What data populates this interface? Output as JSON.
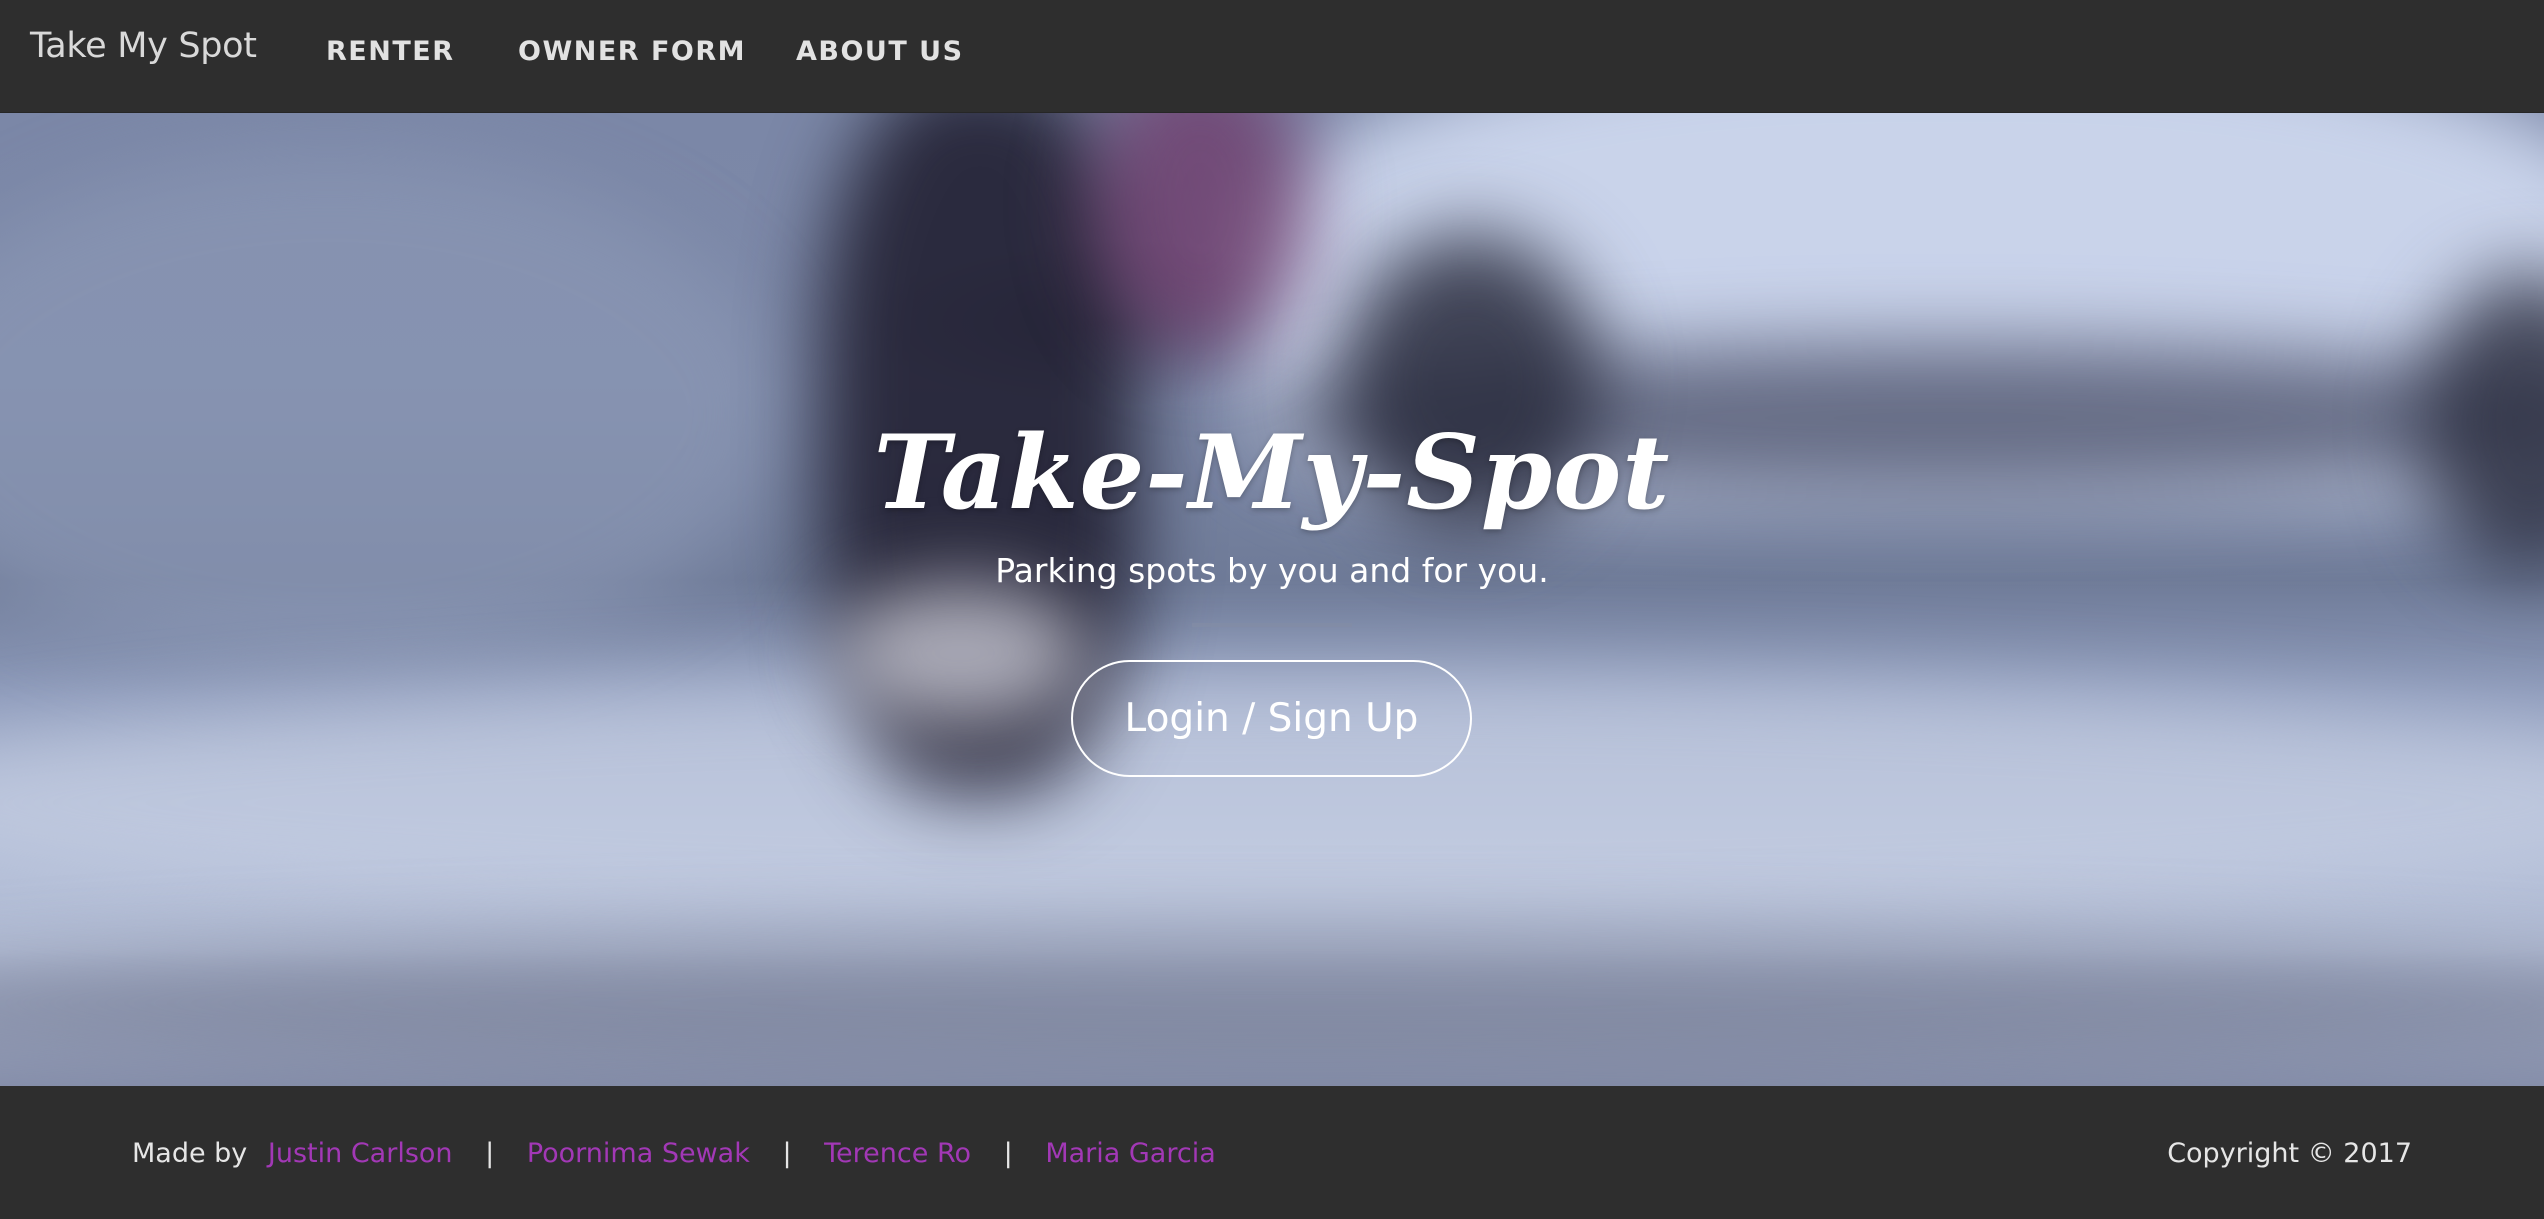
{
  "navbar": {
    "brand": "Take My Spot",
    "links": [
      {
        "label": "RENTER"
      },
      {
        "label": "OWNER FORM"
      },
      {
        "label": "ABOUT US"
      }
    ]
  },
  "hero": {
    "title": "Take-My-Spot",
    "subtitle": "Parking spots by you and for you.",
    "button_label": "Login / Sign Up"
  },
  "footer": {
    "made_by_label": "Made by",
    "authors": [
      {
        "name": "Justin Carlson"
      },
      {
        "name": "Poornima Sewak"
      },
      {
        "name": "Terence Ro"
      },
      {
        "name": "Maria Garcia"
      }
    ],
    "separator": "|",
    "copyright": "Copyright © 2017"
  },
  "colors": {
    "bar_background": "#2e2e2e",
    "author_link": "#a238b6",
    "text_light": "#e6e6e6"
  }
}
